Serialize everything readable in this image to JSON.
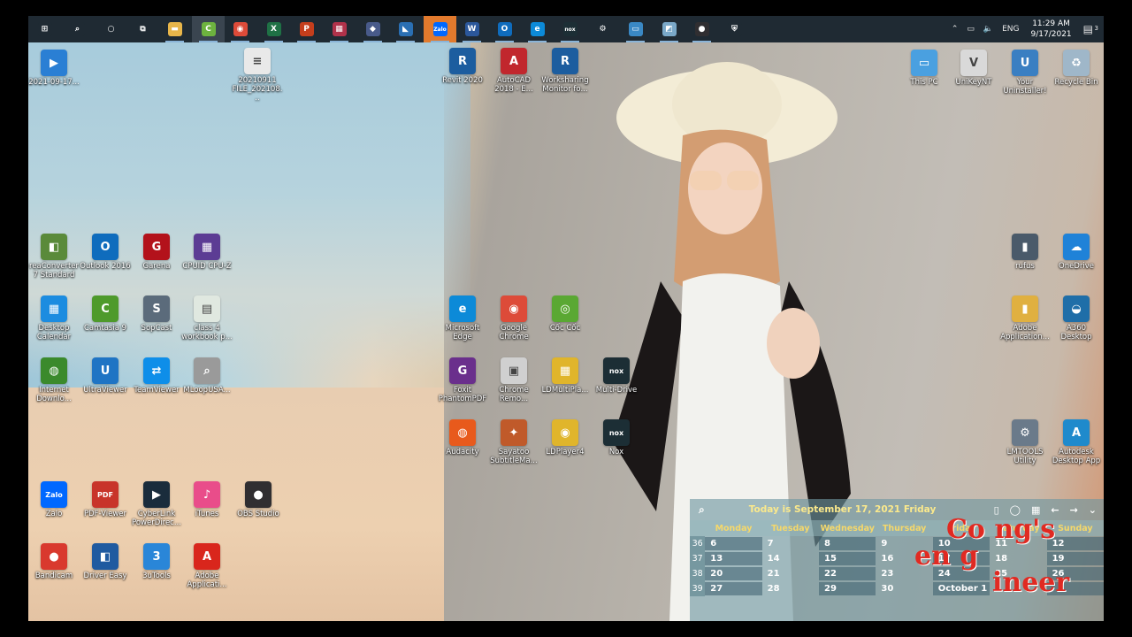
{
  "taskbar": {
    "icons": [
      {
        "name": "windows-start-icon",
        "label": "⊞",
        "color": "#1f2a33"
      },
      {
        "name": "search-icon",
        "label": "⌕",
        "color": "#1f2a33"
      },
      {
        "name": "cortana-icon",
        "label": "○",
        "color": "#1f2a33"
      },
      {
        "name": "task-view-icon",
        "label": "⧉",
        "color": "#1f2a33"
      },
      {
        "name": "file-explorer-icon",
        "label": "▬",
        "color": "#e8b64a"
      },
      {
        "name": "camtasia-icon",
        "label": "C",
        "color": "#6db33f"
      },
      {
        "name": "chrome-icon",
        "label": "◉",
        "color": "#dd4b39"
      },
      {
        "name": "excel-icon",
        "label": "X",
        "color": "#1f7145"
      },
      {
        "name": "powerpoint-icon",
        "label": "P",
        "color": "#c43e1c"
      },
      {
        "name": "app-icon",
        "label": "▦",
        "color": "#b0324a"
      },
      {
        "name": "app2-icon",
        "label": "◆",
        "color": "#485a8a"
      },
      {
        "name": "app3-icon",
        "label": "◣",
        "color": "#2a6fb3"
      },
      {
        "name": "zalo-icon",
        "label": "Zalo",
        "color": "#0068ff"
      },
      {
        "name": "word-icon",
        "label": "W",
        "color": "#2b579a"
      },
      {
        "name": "outlook-icon",
        "label": "O",
        "color": "#0f6cbd"
      },
      {
        "name": "edge-icon",
        "label": "e",
        "color": "#0c8ad8"
      },
      {
        "name": "nox-icon",
        "label": "nox",
        "color": "#1c2e35"
      },
      {
        "name": "settings-gear-icon",
        "label": "⚙",
        "color": "#1f2a33"
      },
      {
        "name": "app4-icon",
        "label": "▭",
        "color": "#3a88c4"
      },
      {
        "name": "app5-icon",
        "label": "◩",
        "color": "#7aa8c8"
      },
      {
        "name": "obs-icon",
        "label": "●",
        "color": "#302e31"
      },
      {
        "name": "security-shield-icon",
        "label": "⛨",
        "color": "#1f2a33"
      }
    ],
    "tray": {
      "chevron": "⌃",
      "network": "▭",
      "volume": "🔈",
      "language": "ENG",
      "time": "11:29 AM",
      "date": "9/17/2021",
      "notifications": "3"
    }
  },
  "desktop_icons": [
    {
      "name": "video-file-icon",
      "label": "2021-09-17...",
      "glyph": "▶",
      "color": "#2a7fd4"
    },
    {
      "name": "document-file-icon",
      "label": "20210911 FILE_202108...",
      "glyph": "≡",
      "color": "#e9e9e9"
    },
    {
      "name": "revit-icon",
      "label": "Revit 2020",
      "glyph": "R",
      "color": "#1c5d9f"
    },
    {
      "name": "autocad-icon",
      "label": "AutoCAD 2018 - E...",
      "glyph": "A",
      "color": "#c1272d"
    },
    {
      "name": "worksharing-monitor-icon",
      "label": "Worksharing Monitor fo...",
      "glyph": "R",
      "color": "#1c5d9f"
    },
    {
      "name": "this-pc-icon",
      "label": "This PC",
      "glyph": "▭",
      "color": "#4aa0e0"
    },
    {
      "name": "unikey-icon",
      "label": "UniKeyNT",
      "glyph": "V",
      "color": "#d9d9d9"
    },
    {
      "name": "your-uninstaller-icon",
      "label": "Your Uninstaller!",
      "glyph": "U",
      "color": "#3a7fc2"
    },
    {
      "name": "recycle-bin-icon",
      "label": "Recycle Bin",
      "glyph": "♻",
      "color": "#9fb7c9"
    },
    {
      "name": "reaconverter-icon",
      "label": "reaConverter 7 Standard",
      "glyph": "◧",
      "color": "#5a8a3a"
    },
    {
      "name": "outlook-2016-icon",
      "label": "Outlook 2016",
      "glyph": "O",
      "color": "#0f6cbd"
    },
    {
      "name": "garena-icon",
      "label": "Garena",
      "glyph": "G",
      "color": "#b3121b"
    },
    {
      "name": "cpuid-icon",
      "label": "CPUID CPU-Z",
      "glyph": "▦",
      "color": "#5c3c94"
    },
    {
      "name": "rufus-icon",
      "label": "rufus",
      "glyph": "▮",
      "color": "#4a5a6a"
    },
    {
      "name": "onedrive-icon",
      "label": "OneDrive",
      "glyph": "☁",
      "color": "#1f82d8"
    },
    {
      "name": "desktop-calendar-icon",
      "label": "Desktop Calendar",
      "glyph": "▦",
      "color": "#1c8ce0"
    },
    {
      "name": "camtasia-9-icon",
      "label": "Camtasia 9",
      "glyph": "C",
      "color": "#4e9a2b"
    },
    {
      "name": "sopcast-icon",
      "label": "SopCast",
      "glyph": "S",
      "color": "#5b6b7b"
    },
    {
      "name": "excel-workbook-icon",
      "label": "class 4 workbook p...",
      "glyph": "▤",
      "color": "#e0e8e0"
    },
    {
      "name": "adobe-application-icon",
      "label": "Adobe Application...",
      "glyph": "▮",
      "color": "#e0b040"
    },
    {
      "name": "a360-desktop-icon",
      "label": "A360 Desktop",
      "glyph": "◒",
      "color": "#1f6ea8"
    },
    {
      "name": "idm-icon",
      "label": "Internet Downlo...",
      "glyph": "◍",
      "color": "#3b8a2c"
    },
    {
      "name": "ultraviewer-icon",
      "label": "UltraViewer",
      "glyph": "U",
      "color": "#1f74c4"
    },
    {
      "name": "teamviewer-icon",
      "label": "TeamViewer",
      "glyph": "⇄",
      "color": "#0e8ee9"
    },
    {
      "name": "mloopusa-icon",
      "label": "MLoopUSA...",
      "glyph": "⌕",
      "color": "#9a9a9a"
    },
    {
      "name": "microsoft-edge-icon",
      "label": "Microsoft Edge",
      "glyph": "e",
      "color": "#0c8ad8"
    },
    {
      "name": "google-chrome-icon",
      "label": "Google Chrome",
      "glyph": "◉",
      "color": "#dd4b39"
    },
    {
      "name": "coc-coc-icon",
      "label": "Cốc Cốc",
      "glyph": "◎",
      "color": "#5aa833"
    },
    {
      "name": "foxit-phantompdf-icon",
      "label": "Foxit PhantomPDF",
      "glyph": "G",
      "color": "#6a2f8c"
    },
    {
      "name": "chrome-remote-icon",
      "label": "Chrome Remo...",
      "glyph": "▣",
      "color": "#d0d0d0"
    },
    {
      "name": "ldmultiplayer-icon",
      "label": "LDMultiPla...",
      "glyph": "▦",
      "color": "#e0b52b"
    },
    {
      "name": "multi-drive-icon",
      "label": "Multi-Drive",
      "glyph": "nox",
      "color": "#1c2e35"
    },
    {
      "name": "audacity-icon",
      "label": "Audacity",
      "glyph": "◍",
      "color": "#e85a1c"
    },
    {
      "name": "sayatoo-icon",
      "label": "Sayatoo SubtitleMa...",
      "glyph": "✦",
      "color": "#c05a2a"
    },
    {
      "name": "ldplayer-icon",
      "label": "LDPlayer4",
      "glyph": "◉",
      "color": "#e0b52b"
    },
    {
      "name": "nox-desktop-icon",
      "label": "Nox",
      "glyph": "nox",
      "color": "#1c2e35"
    },
    {
      "name": "lmtools-icon",
      "label": "LMTOOLS Utility",
      "glyph": "⚙",
      "color": "#6a7a8a"
    },
    {
      "name": "autodesk-desktop-app-icon",
      "label": "Autodesk Desktop App",
      "glyph": "A",
      "color": "#1f8acc"
    },
    {
      "name": "zalo-desktop-icon",
      "label": "Zalo",
      "glyph": "Zalo",
      "color": "#0068ff"
    },
    {
      "name": "pdf-viewer-icon",
      "label": "PDF-Viewer",
      "glyph": "PDF",
      "color": "#c8342a"
    },
    {
      "name": "cyberlink-icon",
      "label": "CyberLink PowerDirec...",
      "glyph": "▶",
      "color": "#1a2c3c"
    },
    {
      "name": "itunes-icon",
      "label": "iTunes",
      "glyph": "♪",
      "color": "#e94d8a"
    },
    {
      "name": "obs-studio-icon",
      "label": "OBS Studio",
      "glyph": "●",
      "color": "#302e31"
    },
    {
      "name": "bandicam-icon",
      "label": "Bandicam",
      "glyph": "●",
      "color": "#d9392e"
    },
    {
      "name": "driver-easy-icon",
      "label": "Driver Easy",
      "glyph": "◧",
      "color": "#1f5aa0"
    },
    {
      "name": "3utools-icon",
      "label": "3uTools",
      "glyph": "3",
      "color": "#2a86d8"
    },
    {
      "name": "adobe-applicati-icon",
      "label": "Adobe Applicati...",
      "glyph": "A",
      "color": "#d9261c"
    }
  ],
  "calendar": {
    "header": "Today is September 17, 2021 Friday",
    "days": [
      "Monday",
      "Tuesday",
      "Wednesday",
      "Thursday",
      "Friday",
      "Saturday",
      "Sunday"
    ],
    "weeks": [
      {
        "wk": "36",
        "dates": [
          "6",
          "7",
          "8",
          "9",
          "10",
          "11",
          "12"
        ]
      },
      {
        "wk": "37",
        "dates": [
          "13",
          "14",
          "15",
          "16",
          "17",
          "18",
          "19"
        ]
      },
      {
        "wk": "38",
        "dates": [
          "20",
          "21",
          "22",
          "23",
          "24",
          "25",
          "26"
        ]
      },
      {
        "wk": "39",
        "dates": [
          "27",
          "28",
          "29",
          "30",
          "October 1",
          "",
          ""
        ]
      }
    ],
    "next_month_label": "October",
    "next_month_day": "1"
  },
  "watermark": {
    "line1": "Co ng's",
    "line2": "en g",
    "line3": "ineer"
  }
}
